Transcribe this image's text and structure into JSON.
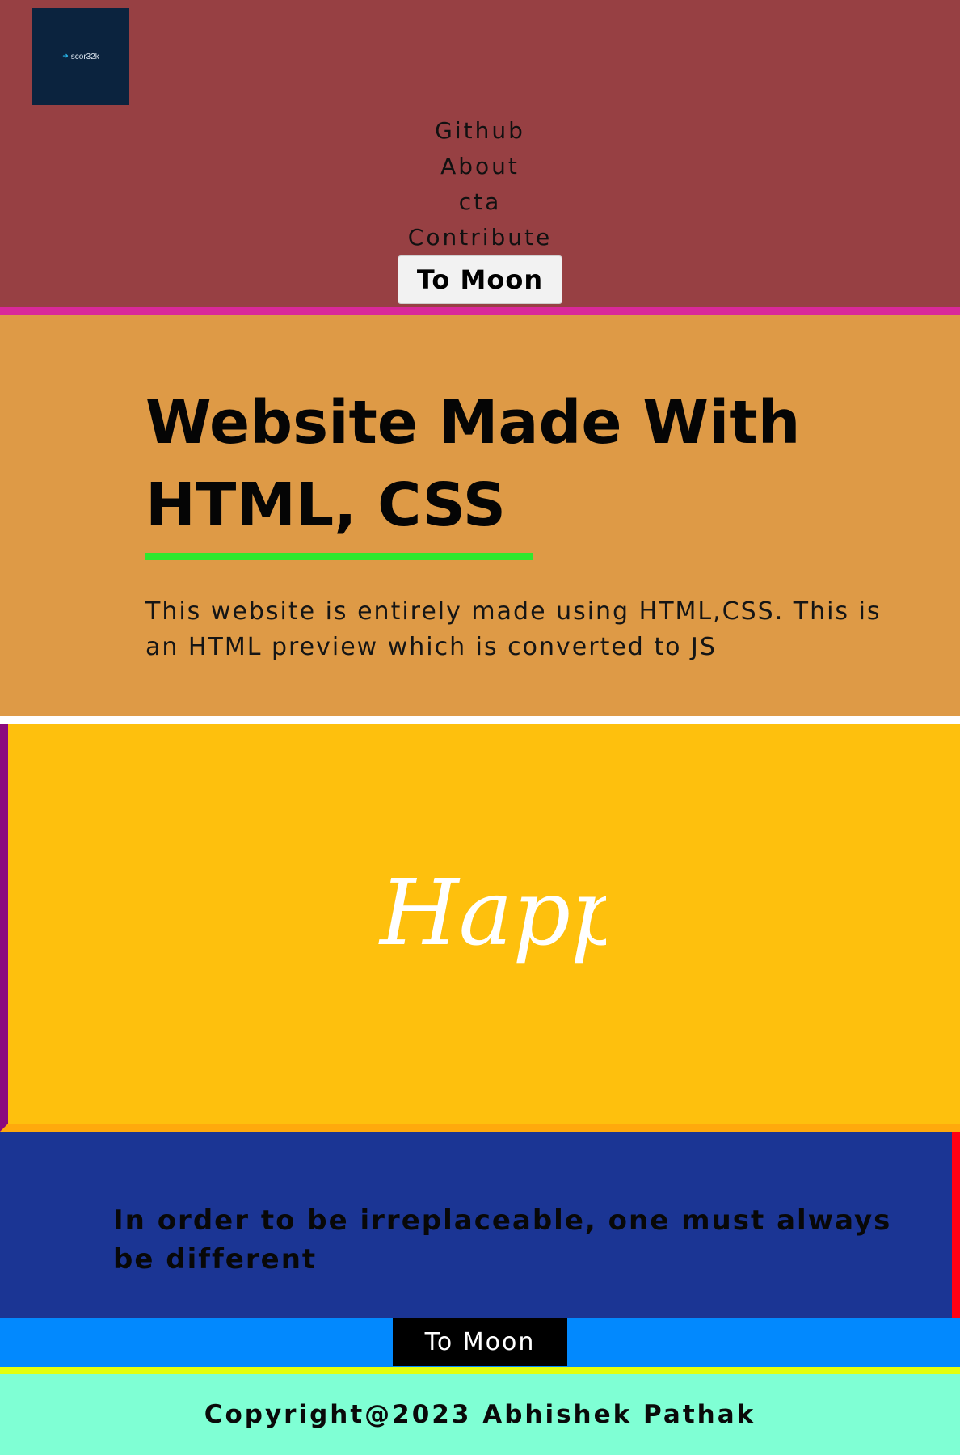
{
  "header": {
    "logo": {
      "icon": "arrow-right-icon",
      "text": "scor32k"
    },
    "nav": [
      {
        "label": "Github"
      },
      {
        "label": "About"
      },
      {
        "label": "cta"
      },
      {
        "label": "Contribute"
      }
    ],
    "cta_label": "To Moon"
  },
  "hero": {
    "title_line1": "Website Made With",
    "title_line2": "HTML, CSS",
    "description": "This website is entirely made using HTML,CSS. This is an HTML preview which is converted to JS"
  },
  "image_band": {
    "image_text": "Happy."
  },
  "quote": {
    "text": "In order to be irreplaceable, one must always be different"
  },
  "cta_bar": {
    "label": "To Moon"
  },
  "footer": {
    "copyright": "Copyright@2023 Abhishek Pathak"
  },
  "colors": {
    "header_bg": "#974043",
    "header_border": "#d9299a",
    "hero_bg": "#de9a46",
    "underline": "#2ee82e",
    "image_bg": "#fec00d",
    "image_border_left": "#8b0a7d",
    "image_border_bottom": "#ffa90c",
    "quote_bg": "#1b3594",
    "quote_border_right": "#ff0012",
    "cta_bar_bg": "#0289fe",
    "cta_bar_border": "#e4ff0c",
    "footer_bg": "#7fffd4",
    "logo_bg": "#0b233e"
  }
}
